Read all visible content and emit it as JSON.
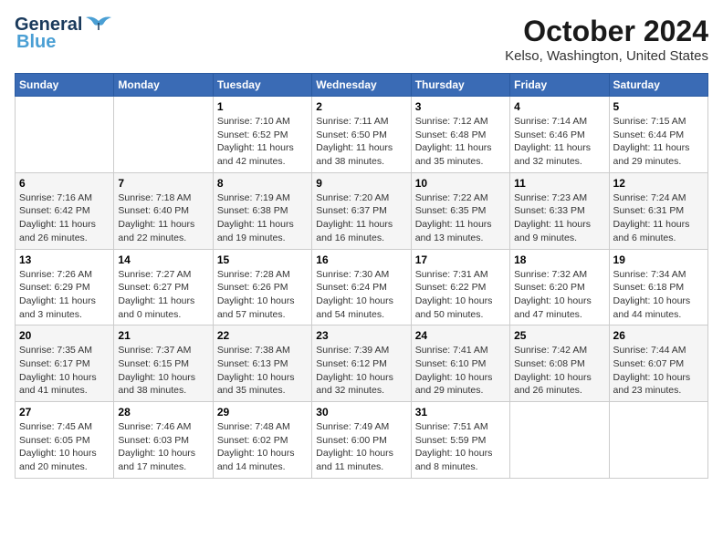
{
  "header": {
    "logo_line1": "General",
    "logo_line2": "Blue",
    "title": "October 2024",
    "subtitle": "Kelso, Washington, United States"
  },
  "weekdays": [
    "Sunday",
    "Monday",
    "Tuesday",
    "Wednesday",
    "Thursday",
    "Friday",
    "Saturday"
  ],
  "weeks": [
    [
      {
        "day": "",
        "info": ""
      },
      {
        "day": "",
        "info": ""
      },
      {
        "day": "1",
        "info": "Sunrise: 7:10 AM\nSunset: 6:52 PM\nDaylight: 11 hours and 42 minutes."
      },
      {
        "day": "2",
        "info": "Sunrise: 7:11 AM\nSunset: 6:50 PM\nDaylight: 11 hours and 38 minutes."
      },
      {
        "day": "3",
        "info": "Sunrise: 7:12 AM\nSunset: 6:48 PM\nDaylight: 11 hours and 35 minutes."
      },
      {
        "day": "4",
        "info": "Sunrise: 7:14 AM\nSunset: 6:46 PM\nDaylight: 11 hours and 32 minutes."
      },
      {
        "day": "5",
        "info": "Sunrise: 7:15 AM\nSunset: 6:44 PM\nDaylight: 11 hours and 29 minutes."
      }
    ],
    [
      {
        "day": "6",
        "info": "Sunrise: 7:16 AM\nSunset: 6:42 PM\nDaylight: 11 hours and 26 minutes."
      },
      {
        "day": "7",
        "info": "Sunrise: 7:18 AM\nSunset: 6:40 PM\nDaylight: 11 hours and 22 minutes."
      },
      {
        "day": "8",
        "info": "Sunrise: 7:19 AM\nSunset: 6:38 PM\nDaylight: 11 hours and 19 minutes."
      },
      {
        "day": "9",
        "info": "Sunrise: 7:20 AM\nSunset: 6:37 PM\nDaylight: 11 hours and 16 minutes."
      },
      {
        "day": "10",
        "info": "Sunrise: 7:22 AM\nSunset: 6:35 PM\nDaylight: 11 hours and 13 minutes."
      },
      {
        "day": "11",
        "info": "Sunrise: 7:23 AM\nSunset: 6:33 PM\nDaylight: 11 hours and 9 minutes."
      },
      {
        "day": "12",
        "info": "Sunrise: 7:24 AM\nSunset: 6:31 PM\nDaylight: 11 hours and 6 minutes."
      }
    ],
    [
      {
        "day": "13",
        "info": "Sunrise: 7:26 AM\nSunset: 6:29 PM\nDaylight: 11 hours and 3 minutes."
      },
      {
        "day": "14",
        "info": "Sunrise: 7:27 AM\nSunset: 6:27 PM\nDaylight: 11 hours and 0 minutes."
      },
      {
        "day": "15",
        "info": "Sunrise: 7:28 AM\nSunset: 6:26 PM\nDaylight: 10 hours and 57 minutes."
      },
      {
        "day": "16",
        "info": "Sunrise: 7:30 AM\nSunset: 6:24 PM\nDaylight: 10 hours and 54 minutes."
      },
      {
        "day": "17",
        "info": "Sunrise: 7:31 AM\nSunset: 6:22 PM\nDaylight: 10 hours and 50 minutes."
      },
      {
        "day": "18",
        "info": "Sunrise: 7:32 AM\nSunset: 6:20 PM\nDaylight: 10 hours and 47 minutes."
      },
      {
        "day": "19",
        "info": "Sunrise: 7:34 AM\nSunset: 6:18 PM\nDaylight: 10 hours and 44 minutes."
      }
    ],
    [
      {
        "day": "20",
        "info": "Sunrise: 7:35 AM\nSunset: 6:17 PM\nDaylight: 10 hours and 41 minutes."
      },
      {
        "day": "21",
        "info": "Sunrise: 7:37 AM\nSunset: 6:15 PM\nDaylight: 10 hours and 38 minutes."
      },
      {
        "day": "22",
        "info": "Sunrise: 7:38 AM\nSunset: 6:13 PM\nDaylight: 10 hours and 35 minutes."
      },
      {
        "day": "23",
        "info": "Sunrise: 7:39 AM\nSunset: 6:12 PM\nDaylight: 10 hours and 32 minutes."
      },
      {
        "day": "24",
        "info": "Sunrise: 7:41 AM\nSunset: 6:10 PM\nDaylight: 10 hours and 29 minutes."
      },
      {
        "day": "25",
        "info": "Sunrise: 7:42 AM\nSunset: 6:08 PM\nDaylight: 10 hours and 26 minutes."
      },
      {
        "day": "26",
        "info": "Sunrise: 7:44 AM\nSunset: 6:07 PM\nDaylight: 10 hours and 23 minutes."
      }
    ],
    [
      {
        "day": "27",
        "info": "Sunrise: 7:45 AM\nSunset: 6:05 PM\nDaylight: 10 hours and 20 minutes."
      },
      {
        "day": "28",
        "info": "Sunrise: 7:46 AM\nSunset: 6:03 PM\nDaylight: 10 hours and 17 minutes."
      },
      {
        "day": "29",
        "info": "Sunrise: 7:48 AM\nSunset: 6:02 PM\nDaylight: 10 hours and 14 minutes."
      },
      {
        "day": "30",
        "info": "Sunrise: 7:49 AM\nSunset: 6:00 PM\nDaylight: 10 hours and 11 minutes."
      },
      {
        "day": "31",
        "info": "Sunrise: 7:51 AM\nSunset: 5:59 PM\nDaylight: 10 hours and 8 minutes."
      },
      {
        "day": "",
        "info": ""
      },
      {
        "day": "",
        "info": ""
      }
    ]
  ]
}
